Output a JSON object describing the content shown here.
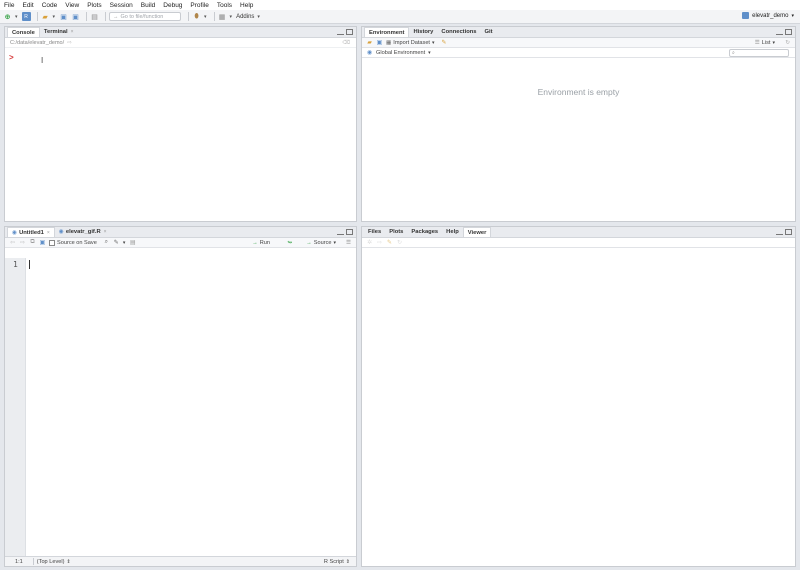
{
  "menu": [
    "File",
    "Edit",
    "Code",
    "View",
    "Plots",
    "Session",
    "Build",
    "Debug",
    "Profile",
    "Tools",
    "Help"
  ],
  "toolbar": {
    "goto_placeholder": "Go to file/function",
    "addins_label": "Addins",
    "project_name": "elevatr_demo"
  },
  "console_pane": {
    "tabs": [
      "Console",
      "Terminal"
    ],
    "path": "C:/data/elevatr_demo/",
    "prompt": ">"
  },
  "editor_pane": {
    "tabs": [
      "Untitled1",
      "elevatr_gif.R"
    ],
    "source_on_save": "Source on Save",
    "run_label": "Run",
    "source_label": "Source",
    "line_number": "1",
    "status_position": "1:1",
    "status_scope": "(Top Level)",
    "status_type": "R Script"
  },
  "env_pane": {
    "tabs": [
      "Environment",
      "History",
      "Connections",
      "Git"
    ],
    "import_label": "Import Dataset",
    "list_label": "List",
    "scope_label": "Global Environment",
    "empty_message": "Environment is empty"
  },
  "files_pane": {
    "tabs": [
      "Files",
      "Plots",
      "Packages",
      "Help",
      "Viewer"
    ]
  },
  "colors": {
    "accent": "#3a7bd5",
    "prompt": "#d63a3a"
  }
}
